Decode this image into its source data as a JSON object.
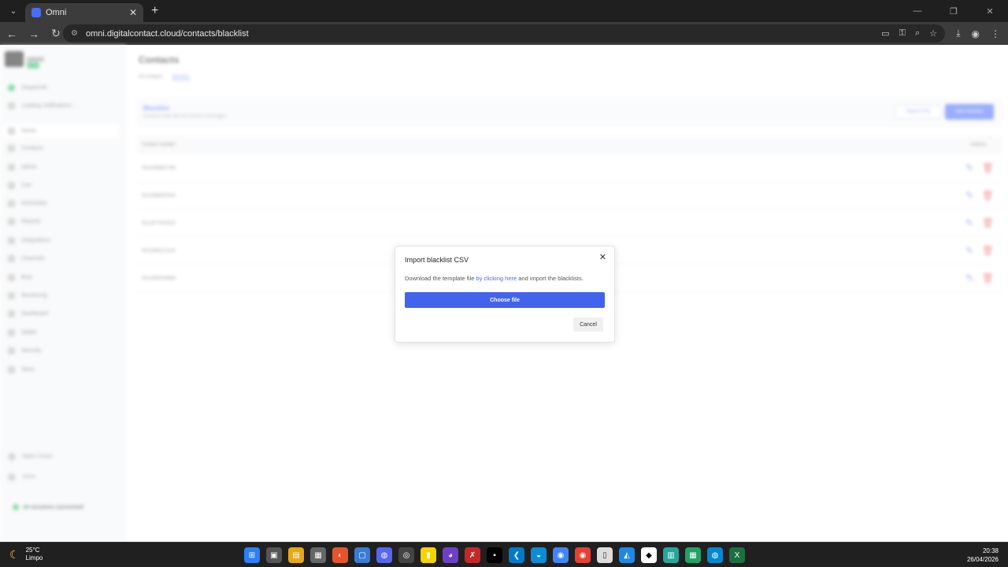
{
  "browser": {
    "tab_title": "Omni",
    "url": "omni.digitalcontact.cloud/contacts/blacklist"
  },
  "sidebar": {
    "items": [
      {
        "label": "Disponível"
      },
      {
        "label": "Loading notifications..."
      },
      {
        "label": "Home"
      },
      {
        "label": "Contacts"
      },
      {
        "label": "Admin"
      },
      {
        "label": "Live"
      },
      {
        "label": "Schedules"
      },
      {
        "label": "Reports"
      },
      {
        "label": "Integrations"
      },
      {
        "label": "Channels"
      },
      {
        "label": "Bots"
      },
      {
        "label": "Monitoring"
      },
      {
        "label": "Dashboard"
      },
      {
        "label": "Wallet"
      },
      {
        "label": "Security"
      },
      {
        "label": "Store"
      }
    ],
    "bottom_items": [
      {
        "label": "Digital Contact"
      },
      {
        "label": "Admin"
      }
    ],
    "status_text": "10 sessions connected"
  },
  "main": {
    "title": "Contacts",
    "tabs": [
      "All contacts",
      "Blacklist"
    ],
    "card": {
      "title": "Blacklist",
      "subtitle": "Contacts that will not receive messages",
      "import_label": "Import CSV",
      "new_label": "New blacklist"
    },
    "table": {
      "headers": [
        "Contact number",
        "Actions"
      ],
      "rows": [
        "5511999887766",
        "5511988665544",
        "5511977443322",
        "5511966221100",
        "5511955009988"
      ]
    }
  },
  "modal": {
    "title": "Import blacklist CSV",
    "text_before": "Download the template file ",
    "link_text": "by clicking here",
    "text_after": " and import the blacklists.",
    "choose_label": "Choose file",
    "cancel_label": "Cancel"
  },
  "taskbar": {
    "temperature": "25°C",
    "weather": "Limpo",
    "time": "20:38",
    "date": "26/04/2026"
  }
}
